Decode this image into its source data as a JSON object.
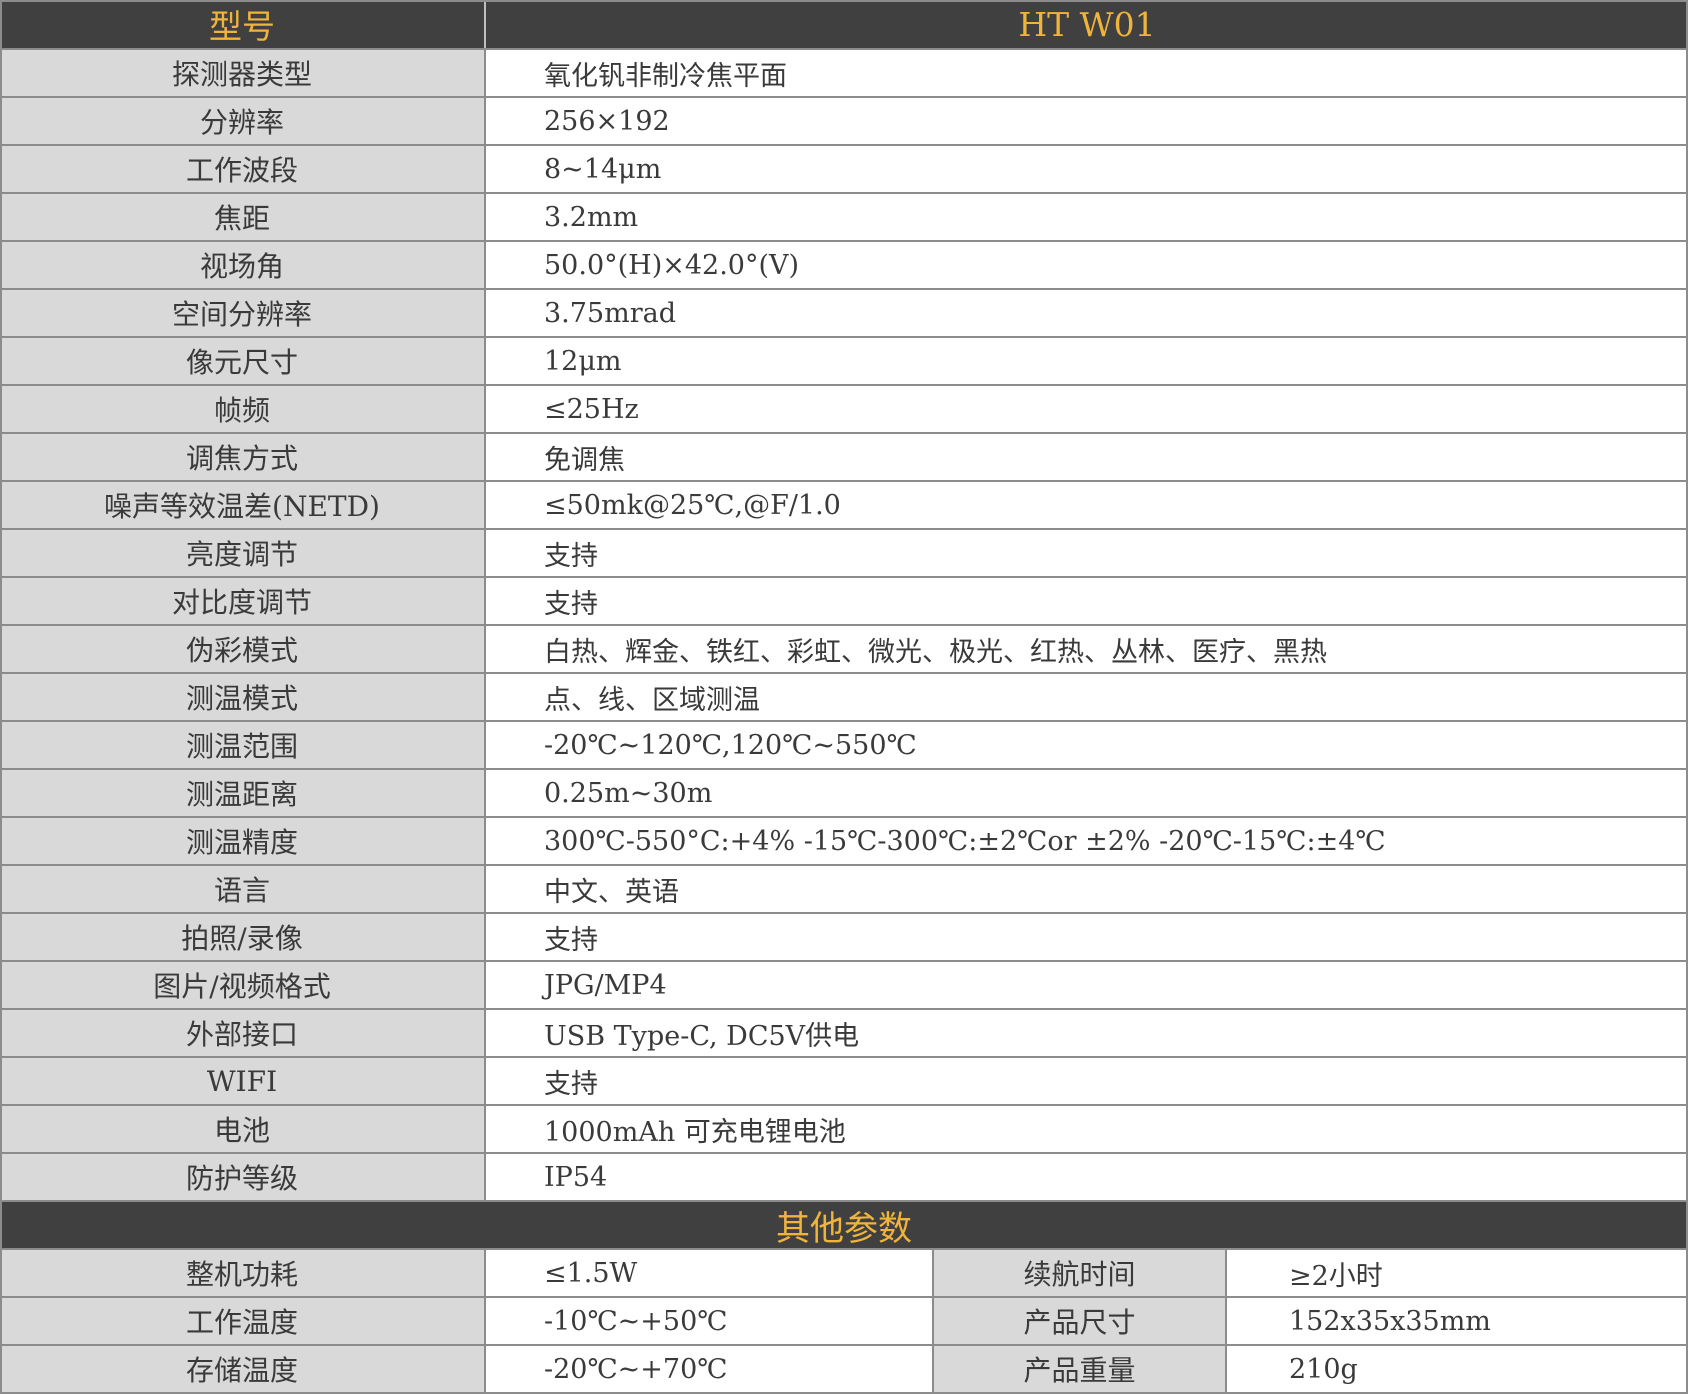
{
  "header": {
    "col1": "型号",
    "col2": "HT W01"
  },
  "specs": [
    {
      "label": "探测器类型",
      "value": "氧化钒非制冷焦平面"
    },
    {
      "label": "分辨率",
      "value": "256×192"
    },
    {
      "label": "工作波段",
      "value": "8~14μm"
    },
    {
      "label": "焦距",
      "value": "3.2mm"
    },
    {
      "label": "视场角",
      "value": "50.0°(H)×42.0°(V)"
    },
    {
      "label": "空间分辨率",
      "value": "3.75mrad"
    },
    {
      "label": "像元尺寸",
      "value": "12μm"
    },
    {
      "label": "帧频",
      "value": "≤25Hz"
    },
    {
      "label": "调焦方式",
      "value": "免调焦"
    },
    {
      "label": "噪声等效温差(NETD)",
      "value": "≤50mk@25℃,@F/1.0"
    },
    {
      "label": "亮度调节",
      "value": "支持"
    },
    {
      "label": "对比度调节",
      "value": "支持"
    },
    {
      "label": "伪彩模式",
      "value": "白热、辉金、铁红、彩虹、微光、极光、红热、丛林、医疗、黑热"
    },
    {
      "label": "测温模式",
      "value": "点、线、区域测温"
    },
    {
      "label": "测温范围",
      "value": "-20℃~120℃,120℃~550℃"
    },
    {
      "label": "测温距离",
      "value": "0.25m~30m"
    },
    {
      "label": "测温精度",
      "value": "300℃-550°C:+4% -15℃-300℃:±2℃or ±2% -20℃-15℃:±4℃"
    },
    {
      "label": "语言",
      "value": "中文、英语"
    },
    {
      "label": "拍照/录像",
      "value": "支持"
    },
    {
      "label": "图片/视频格式",
      "value": "JPG/MP4"
    },
    {
      "label": "外部接口",
      "value": "USB Type-C, DC5V供电"
    },
    {
      "label": "WIFI",
      "value": "支持"
    },
    {
      "label": "电池",
      "value": "1000mAh 可充电锂电池"
    },
    {
      "label": "防护等级",
      "value": "IP54"
    }
  ],
  "other_section": {
    "title": "其他参数"
  },
  "other": [
    {
      "label1": "整机功耗",
      "value1": "≤1.5W",
      "label2": "续航时间",
      "value2": "≥2小时"
    },
    {
      "label1": "工作温度",
      "value1": "-10℃~+50℃",
      "label2": "产品尺寸",
      "value2": "152x35x35mm"
    },
    {
      "label1": "存储温度",
      "value1": "-20℃~+70℃",
      "label2": "产品重量",
      "value2": "210g"
    }
  ]
}
